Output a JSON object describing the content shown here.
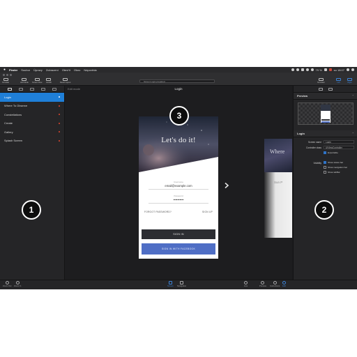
{
  "menubar": {
    "app": "Finder",
    "items": [
      "Soubor",
      "Úpravy",
      "Zobrazení",
      "Otevřít",
      "Okno",
      "Nápověda"
    ],
    "battery": "79 %",
    "clock": "so 18:07"
  },
  "toolbar": {
    "left_buttons": [
      "Simulate",
      "Add Mode",
      "Screen Flow",
      "Autofill",
      "Reset Layout"
    ],
    "search_text": "Screen Login prepared",
    "right_buttons": [
      "Simulator",
      "Left",
      "Right"
    ]
  },
  "sidebar": {
    "items": [
      {
        "label": "Login",
        "active": true
      },
      {
        "label": "Where To Observe",
        "active": false
      },
      {
        "label": "Constellations",
        "active": false
      },
      {
        "label": "Create",
        "active": false
      },
      {
        "label": "Gallery",
        "active": false
      },
      {
        "label": "Splash Screen",
        "active": false
      }
    ]
  },
  "canvas": {
    "edit_mode": "Edit mode",
    "title": "Login"
  },
  "login_screen": {
    "hero_title": "Let's do it!",
    "username_label": "Username",
    "username_value": "email@example.com",
    "password_label": "Password",
    "password_value": "••••••••••",
    "forgot_password": "FORGOT PASSWORD?",
    "sign_up": "SIGN UP",
    "sign_in": "SIGN IN",
    "sign_in_facebook": "SIGN IN WITH FACEBOOK"
  },
  "next_screen": {
    "title": "Where",
    "subtitle": "Sun P"
  },
  "bottombar": {
    "left": [
      "Zoom Out",
      "Zoom In"
    ],
    "center": [
      "Screen",
      "Navigation"
    ],
    "right": [
      "Live",
      "Preview",
      "Instructions",
      "Edit"
    ]
  },
  "inspector": {
    "preview_label": "Preview",
    "section_label": "Login",
    "screen_name_label": "Screen name",
    "screen_name_value": "Login",
    "controller_class_label": "Controller class",
    "controller_class_value": "UIViewController",
    "exportable_label": "Exportable",
    "visibility_label": "Visibility",
    "visibility_options": [
      "Show status bar",
      "Show navigation bar",
      "Show tabBar"
    ]
  },
  "badges": [
    "1",
    "2",
    "3"
  ],
  "colors": {
    "accent": "#1f7fd8",
    "facebook": "#4f6ec5",
    "dot_red": "#e2462f",
    "dark_button": "#2c2d32"
  }
}
